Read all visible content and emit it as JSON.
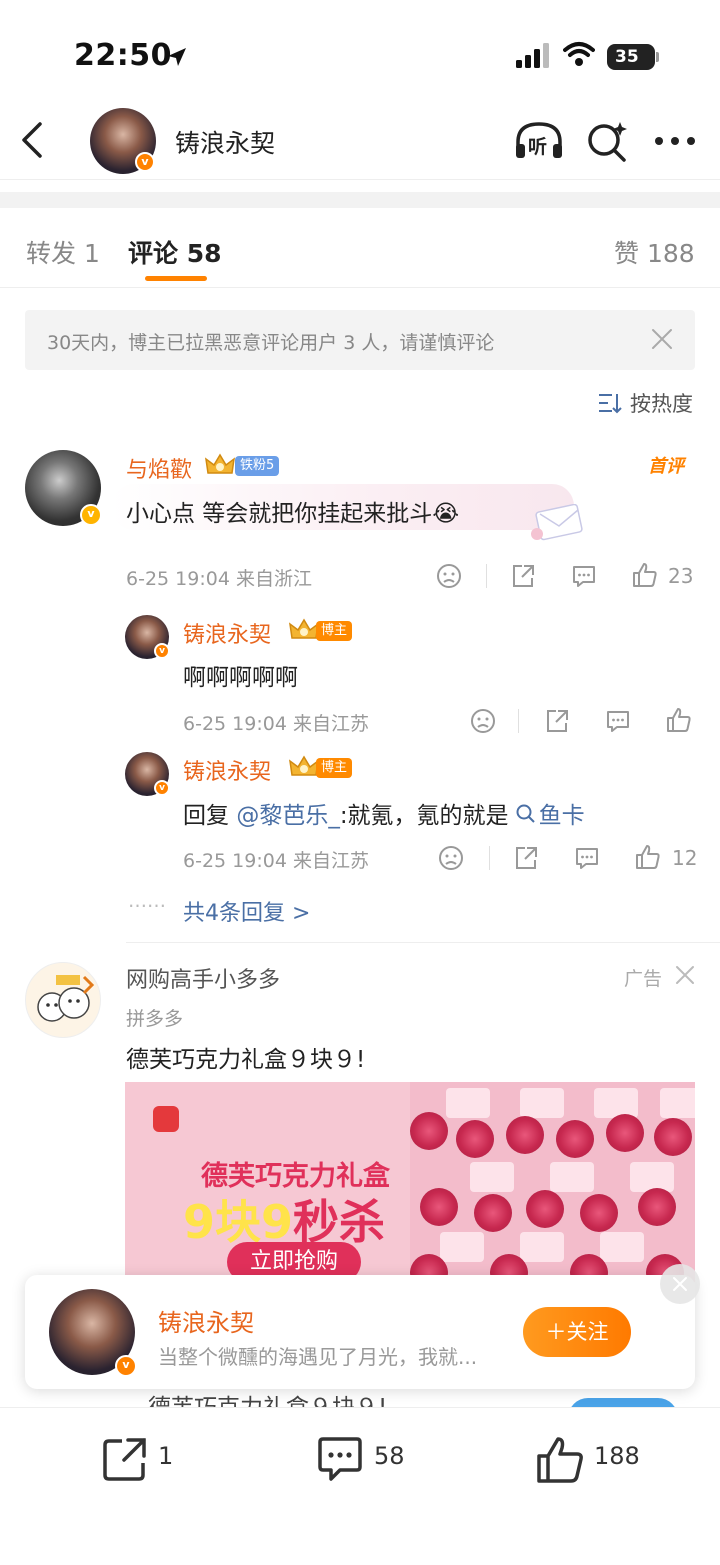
{
  "status_bar": {
    "time": "22:50",
    "battery": "35"
  },
  "nav": {
    "title": "铸浪永契",
    "listen_label": "听"
  },
  "tabs": [
    {
      "label": "转发 1"
    },
    {
      "label": "评论 58"
    },
    {
      "label": "赞 188"
    }
  ],
  "notice": {
    "text": "30天内，博主已拉黑恶意评论用户 3 人，请谨慎评论"
  },
  "sort": {
    "label": "按热度"
  },
  "comments": {
    "main": {
      "username": "与焰歡",
      "fan_badge": "铁粉5",
      "first_label": "首评",
      "text": "小心点 等会就把你挂起来批斗😭",
      "meta": "6-25 19:04  来自浙江",
      "likes": "23"
    },
    "reply1": {
      "username": "铸浪永契",
      "badge": "博主",
      "text": "啊啊啊啊啊",
      "meta": "6-25 19:04  来自江苏"
    },
    "reply2": {
      "username": "铸浪永契",
      "badge": "博主",
      "text_prefix": "回复 ",
      "mention": "@黎芭乐_",
      "text_mid": ":就氪，氪的就是",
      "topic": "鱼卡",
      "meta": "6-25 19:04  来自江苏",
      "likes": "12"
    },
    "more_replies": {
      "dots": "……",
      "label": "共4条回复 >"
    }
  },
  "ad": {
    "username": "网购高手小多多",
    "tag": "广告",
    "source": "拼多多",
    "title": "德芙巧克力礼盒９块９!",
    "image": {
      "headline": "德芙巧克力礼盒",
      "price_part": "9块9",
      "sale_part": "秒杀",
      "button": "立即抢购"
    }
  },
  "follow_card": {
    "name": "铸浪永契",
    "desc": "当整个微醺的海遇见了月光，我就...",
    "button": "＋关注"
  },
  "behind_text": "德芙巧克力礼盒９块９!",
  "bottom_bar": {
    "repost": "1",
    "comment": "58",
    "like": "188"
  },
  "colors": {
    "accent": "#ff8200",
    "username": "#e8661e",
    "link": "#4a6fa5"
  }
}
